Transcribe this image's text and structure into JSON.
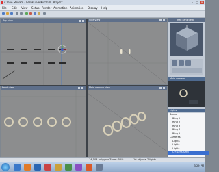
{
  "window": {
    "title": "iClone Stream - Lernkurve Kurzfulli.iProject"
  },
  "menu": [
    "File",
    "Edit",
    "View",
    "Setup",
    "Render",
    "Animation",
    "Animation",
    "Display",
    "Help"
  ],
  "viewports": [
    {
      "key": "top",
      "title": "Top view"
    },
    {
      "key": "side",
      "title": "Side view"
    },
    {
      "key": "front",
      "title": "Front view"
    },
    {
      "key": "main",
      "title": "Main camera view"
    }
  ],
  "right_panel": {
    "tabs": [
      "Reg Lens Setti"
    ],
    "camera_section_label": "Main camera",
    "scene_graph_label": "Lights",
    "tree_items": [
      "Scene",
      "Ring 1",
      "Ring 2",
      "Ring 3",
      "Ring 4",
      "Ring 5",
      "Cameras",
      "Lights",
      "Lights",
      "Lights",
      "Cyl Lens Setti"
    ],
    "selected_item": "Cyl Lens Setti"
  },
  "status": {
    "left": "Zoom: 52%",
    "middle": "16 objects  7 lights",
    "right": "14,504 polygons"
  },
  "clock": {
    "time": "3:29 PM"
  },
  "colors": {
    "viewport_bg": "#8c8d8e",
    "viewport_header": "#5e6f8a",
    "active_border": "#2b7bd3",
    "selected_row": "#3a6fd0"
  }
}
